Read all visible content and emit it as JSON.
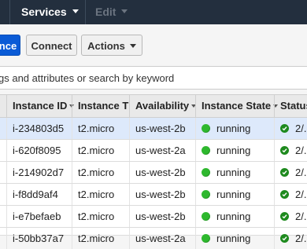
{
  "topnav": {
    "services_label": "Services",
    "edit_label": "Edit"
  },
  "toolbar": {
    "launch_label": "nce",
    "connect_label": "Connect",
    "actions_label": "Actions"
  },
  "filter": {
    "placeholder": "gs and attributes or search by keyword"
  },
  "table": {
    "columns": [
      "Instance ID",
      "Instance T",
      "Availability",
      "Instance State",
      "Status"
    ],
    "rows": [
      {
        "id": "i-234803d5",
        "type": "t2.micro",
        "az": "us-west-2b",
        "state": "running",
        "status": "2/."
      },
      {
        "id": "i-620f8095",
        "type": "t2.micro",
        "az": "us-west-2a",
        "state": "running",
        "status": "2/."
      },
      {
        "id": "i-214902d7",
        "type": "t2.micro",
        "az": "us-west-2b",
        "state": "running",
        "status": "2/."
      },
      {
        "id": "i-f8dd9af4",
        "type": "t2.micro",
        "az": "us-west-2b",
        "state": "running",
        "status": "2/."
      },
      {
        "id": "i-e7befaeb",
        "type": "t2.micro",
        "az": "us-west-2b",
        "state": "running",
        "status": "2/."
      },
      {
        "id": "i-50bb37a7",
        "type": "t2.micro",
        "az": "us-west-2a",
        "state": "running",
        "status": "2/."
      }
    ]
  },
  "colors": {
    "nav_bg": "#232f3e",
    "primary": "#0a5bd6",
    "running": "#2eb82e",
    "selected_row": "#dde9fb"
  },
  "icons": {
    "state": "running-status-dot-icon",
    "status": "status-check-icon"
  }
}
